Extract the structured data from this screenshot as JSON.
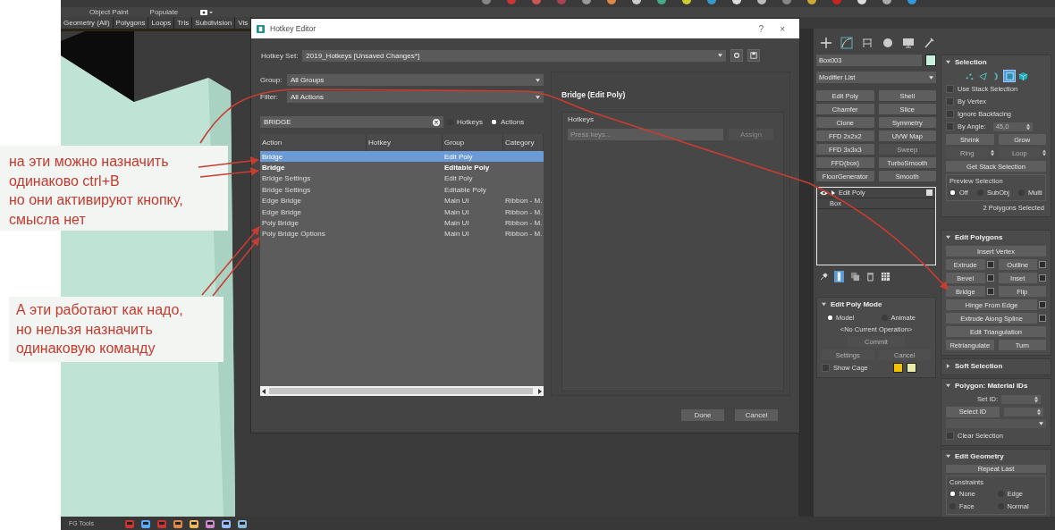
{
  "ribbon_tabs": [
    "Object Paint",
    "Populate"
  ],
  "selection_tabs": [
    "Geometry (All)",
    "Polygons",
    "Loops",
    "Tris",
    "Subdivision",
    "Vis"
  ],
  "notes": [
    "на эти можно назначить\nодинаково ctrl+B\nно они активируют кнопку,\nсмысла нет",
    "А эти работают как надо,\nно нельзя назначить\nодинаковую команду"
  ],
  "hotkey_editor": {
    "title": "Hotkey Editor",
    "help": "?",
    "close": "×",
    "hotkey_set_label": "Hotkey Set:",
    "hotkey_set": "2019_Hotkeys [Unsaved Changes*]",
    "group_label": "Group:",
    "group": "All Groups",
    "filter_label": "Filter:",
    "filter": "All Actions",
    "search": "BRIDGE",
    "search_modes": [
      {
        "label": "Hotkeys",
        "selected": false
      },
      {
        "label": "Actions",
        "selected": true
      }
    ],
    "columns": [
      "Action",
      "Hotkey",
      "Group",
      "Category"
    ],
    "rows": [
      {
        "action": "Bridge",
        "group": "Edit Poly",
        "selected": true,
        "bold": false
      },
      {
        "action": "Bridge",
        "group": "Editable Poly",
        "selected": false,
        "bold": true
      },
      {
        "action": "Bridge Settings",
        "group": "Edit Poly",
        "selected": false,
        "bold": false
      },
      {
        "action": "Bridge Settings",
        "group": "Editable Poly",
        "selected": false,
        "bold": false
      },
      {
        "action": "Edge Bridge",
        "group": "Main UI",
        "category": "Ribbon - M.",
        "selected": false,
        "bold": false
      },
      {
        "action": "Edge Bridge",
        "group": "Main UI",
        "category": "Ribbon - M.",
        "selected": false,
        "bold": false
      },
      {
        "action": "Poly Bridge",
        "group": "Main UI",
        "category": "Ribbon - M.",
        "selected": false,
        "bold": false
      },
      {
        "action": "Poly Bridge Options",
        "group": "Main UI",
        "category": "Ribbon - M.",
        "selected": false,
        "bold": false
      }
    ],
    "detail_title": "Bridge (Edit Poly)",
    "hotkeys_label": "Hotkeys",
    "press_keys": {
      "placeholder": "Press keys..."
    },
    "assign": {
      "label": "Assign",
      "disabled": true
    },
    "buttons": [
      "Done",
      "Cancel"
    ]
  },
  "command_panel": {
    "object_name": "Box003",
    "modifier_list": "Modifier List",
    "modifier_buttons": [
      {
        "label": "Edit Poly",
        "disabled": false
      },
      {
        "label": "Shell",
        "disabled": false
      },
      {
        "label": "Chamfer",
        "disabled": false
      },
      {
        "label": "Slice",
        "disabled": false
      },
      {
        "label": "Clone",
        "disabled": false
      },
      {
        "label": "Symmetry",
        "disabled": false
      },
      {
        "label": "FFD 2x2x2",
        "disabled": false
      },
      {
        "label": "UVW Map",
        "disabled": false
      },
      {
        "label": "FFD 3x3x3",
        "disabled": false
      },
      {
        "label": "Sweep",
        "disabled": true
      },
      {
        "label": "FFD(box)",
        "disabled": false
      },
      {
        "label": "TurboSmooth",
        "disabled": false
      },
      {
        "label": "FloorGenerator",
        "disabled": false
      },
      {
        "label": "Smooth",
        "disabled": false
      }
    ],
    "stack": [
      {
        "label": "Edit Poly",
        "kind": "modifier"
      },
      {
        "label": "Box",
        "kind": "base"
      }
    ],
    "show_end_result": true,
    "edit_poly_mode": {
      "title": "Edit Poly Mode",
      "expanded": true,
      "modes": [
        {
          "label": "Model",
          "selected": true
        },
        {
          "label": "Animate",
          "selected": false
        }
      ],
      "operation": "<No Current Operation>",
      "buttons": [
        {
          "label": "Commit",
          "kind": "narrow",
          "disabled": true
        },
        {
          "label": "Settings",
          "kind": "half",
          "disabled": true
        },
        {
          "label": "Cancel",
          "kind": "half",
          "disabled": true
        }
      ],
      "show_cage": {
        "label": "Show Cage",
        "checked": false
      }
    },
    "selection": {
      "title": "Selection",
      "expanded": true,
      "levels": [
        {
          "kind": "vertex",
          "selected": false
        },
        {
          "kind": "edge",
          "selected": false
        },
        {
          "kind": "border",
          "selected": false
        },
        {
          "kind": "polygon",
          "selected": true
        },
        {
          "kind": "element",
          "selected": false
        }
      ],
      "options": [
        {
          "label": "Use Stack Selection",
          "checked": false
        },
        {
          "label": "By Vertex",
          "checked": false
        },
        {
          "label": "Ignore Backfacing",
          "checked": false
        },
        {
          "label": "By Angle:",
          "checked": false,
          "value": "45,0"
        }
      ],
      "buttons": [
        {
          "label": "Shrink",
          "kind": "half",
          "disabled": false
        },
        {
          "label": "Grow",
          "kind": "half",
          "disabled": false
        },
        {
          "label": "Ring",
          "kind": "spinner",
          "disabled": true
        },
        {
          "label": "Loop",
          "kind": "spinner",
          "disabled": true
        },
        {
          "label": "Get Stack Selection",
          "kind": "wide",
          "disabled": false
        }
      ],
      "preview_label": "Preview Selection",
      "preview": [
        {
          "label": "Off",
          "selected": true
        },
        {
          "label": "SubObj",
          "selected": false
        },
        {
          "label": "Multi",
          "selected": false
        }
      ],
      "status": "2 Polygons Selected"
    },
    "edit_polygons": {
      "title": "Edit Polygons",
      "expanded": true,
      "buttons": [
        {
          "label": "Insert Vertex",
          "kind": "wide",
          "settings": false
        },
        {
          "label": "Extrude",
          "kind": "half",
          "settings": true
        },
        {
          "label": "Outline",
          "kind": "half",
          "settings": true
        },
        {
          "label": "Bevel",
          "kind": "half",
          "settings": true
        },
        {
          "label": "Inset",
          "kind": "half",
          "settings": true
        },
        {
          "label": "Bridge",
          "kind": "half",
          "settings": true
        },
        {
          "label": "Flip",
          "kind": "half",
          "settings": false
        },
        {
          "label": "Hinge From Edge",
          "kind": "wide",
          "settings": true
        },
        {
          "label": "Extrude Along Spline",
          "kind": "wide",
          "settings": true
        },
        {
          "label": "Edit Triangulation",
          "kind": "wide",
          "settings": false
        },
        {
          "label": "Retriangulate",
          "kind": "half",
          "settings": false
        },
        {
          "label": "Turn",
          "kind": "half",
          "settings": false
        }
      ]
    },
    "soft_selection": {
      "title": "Soft Selection",
      "expanded": false
    },
    "material_ids": {
      "title": "Polygon: Material IDs",
      "expanded": true,
      "set_id_label": "Set ID:",
      "select_id": "Select ID",
      "clear_selection": {
        "label": "Clear Selection",
        "checked": false
      }
    },
    "edit_geometry": {
      "title": "Edit Geometry",
      "expanded": true,
      "repeat_last": "Repeat Last",
      "constraints_label": "Constraints",
      "constraints": [
        {
          "label": "None",
          "selected": true
        },
        {
          "label": "Edge",
          "selected": false
        },
        {
          "label": "Face",
          "selected": false
        },
        {
          "label": "Normal",
          "selected": false
        }
      ]
    }
  },
  "bottom_bar": {
    "label": "FG Tools"
  }
}
